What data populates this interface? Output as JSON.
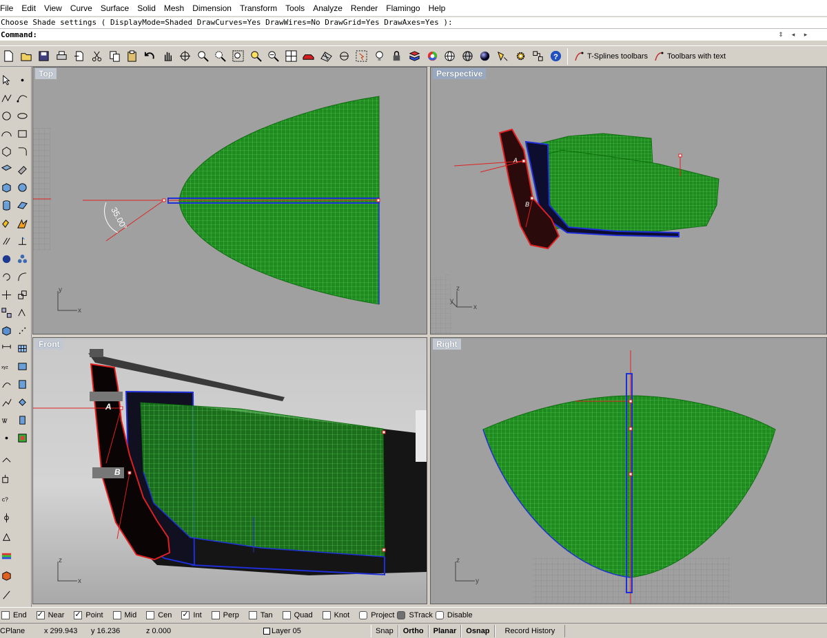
{
  "menu": [
    "File",
    "Edit",
    "View",
    "Curve",
    "Surface",
    "Solid",
    "Mesh",
    "Dimension",
    "Transform",
    "Tools",
    "Analyze",
    "Render",
    "Flamingo",
    "Help"
  ],
  "command_history": "Choose Shade settings ( DisplayMode=Shaded  DrawCurves=Yes  DrawWires=No  DrawGrid=Yes  DrawAxes=Yes ):",
  "command_prompt": "Command:",
  "toolbar": {
    "tsplines_label": "T-Splines toolbars",
    "toolbars_text_label": "Toolbars with text"
  },
  "viewports": {
    "top": {
      "title": "Top",
      "angle_label": "35.00°",
      "axis_x": "x",
      "axis_y": "y"
    },
    "perspective": {
      "title": "Perspective",
      "point_a": "A",
      "point_b": "B",
      "axis_z": "z",
      "axis_y": "y",
      "axis_x": "x"
    },
    "front": {
      "title": "Front",
      "point_a": "A",
      "point_b": "B",
      "axis_z": "z",
      "axis_x": "x"
    },
    "right": {
      "title": "Right",
      "axis_z": "z",
      "axis_y": "y"
    }
  },
  "osnaps": [
    {
      "label": "End",
      "checked": false
    },
    {
      "label": "Near",
      "checked": true
    },
    {
      "label": "Point",
      "checked": true
    },
    {
      "label": "Mid",
      "checked": false
    },
    {
      "label": "Cen",
      "checked": false
    },
    {
      "label": "Int",
      "checked": true
    },
    {
      "label": "Perp",
      "checked": false
    },
    {
      "label": "Tan",
      "checked": false
    },
    {
      "label": "Quad",
      "checked": false
    },
    {
      "label": "Knot",
      "checked": false
    },
    {
      "label": "Project",
      "checked": false
    },
    {
      "label": "STrack",
      "checked": false,
      "filled": true
    },
    {
      "label": "Disable",
      "checked": false
    }
  ],
  "status": {
    "cplane": "CPlane",
    "x": "x 299.943",
    "y": "y 16.236",
    "z": "z 0.000",
    "layer": "Layer 05",
    "snap": "Snap",
    "ortho": "Ortho",
    "planar": "Planar",
    "osnap": "Osnap",
    "record_history": "Record History"
  },
  "colors": {
    "surface_green": "#1f8a1f",
    "mesh_line": "#4fd44f",
    "curve_blue": "#1f2fd8",
    "curve_red": "#e02020",
    "viewport_bg": "#a0a0a0",
    "ui_gray": "#d4d0c8"
  }
}
